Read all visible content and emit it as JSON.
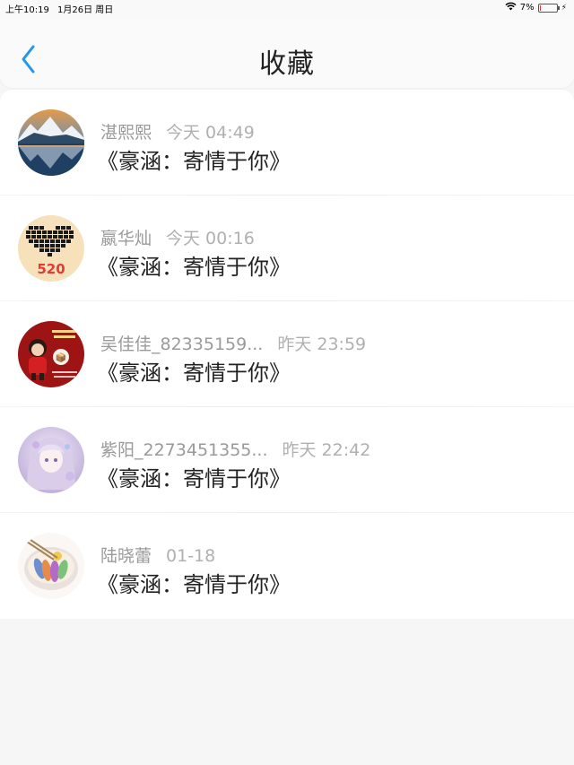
{
  "status_bar": {
    "time": "上午10:19",
    "date": "1月26日 周日",
    "battery_pct": "7%",
    "battery_level": 0.07
  },
  "nav": {
    "title": "收藏"
  },
  "favorites": [
    {
      "name": "湛熙熙",
      "time": "今天 04:49",
      "content": "《豪涵：寄情于你》",
      "avatar": "mountain-lake-avatar"
    },
    {
      "name": "嬴华灿",
      "time": "今天 00:16",
      "content": "《豪涵：寄情于你》",
      "avatar": "pixel-heart-520-avatar"
    },
    {
      "name": "吴佳佳_82335159...",
      "time": "昨天 23:59",
      "content": "《豪涵：寄情于你》",
      "avatar": "red-poster-avatar"
    },
    {
      "name": "紫阳_2273451355...",
      "time": "昨天 22:42",
      "content": "《豪涵：寄情于你》",
      "avatar": "anime-girl-avatar"
    },
    {
      "name": "陆晓蕾",
      "time": "01-18",
      "content": "《豪涵：寄情于你》",
      "avatar": "food-bowl-avatar"
    }
  ]
}
